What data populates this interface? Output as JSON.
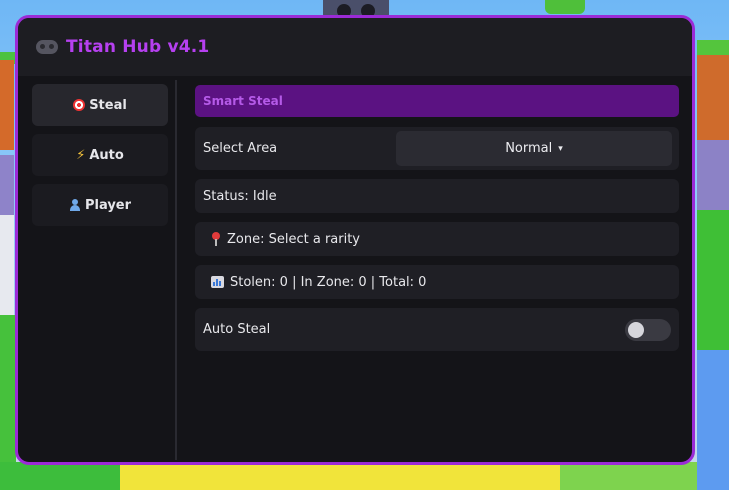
{
  "window": {
    "title": "Titan Hub v4.1",
    "title_icon": "gamepad-icon",
    "accent_color": "#9b2bd6"
  },
  "sidebar": {
    "items": [
      {
        "label": "Steal",
        "icon": "target-icon",
        "active": true
      },
      {
        "label": "Auto",
        "icon": "lightning-icon",
        "active": false
      },
      {
        "label": "Player",
        "icon": "person-icon",
        "active": false
      }
    ]
  },
  "main": {
    "section_title": "Smart Steal",
    "select_area": {
      "label": "Select Area",
      "value": "Normal",
      "caret": "▾"
    },
    "status_text": "Status: Idle",
    "zone_text": "Zone: Select a rarity",
    "stats_text": "Stolen: 0 | In Zone: 0 | Total: 0",
    "auto_steal": {
      "label": "Auto Steal",
      "enabled": false
    }
  }
}
